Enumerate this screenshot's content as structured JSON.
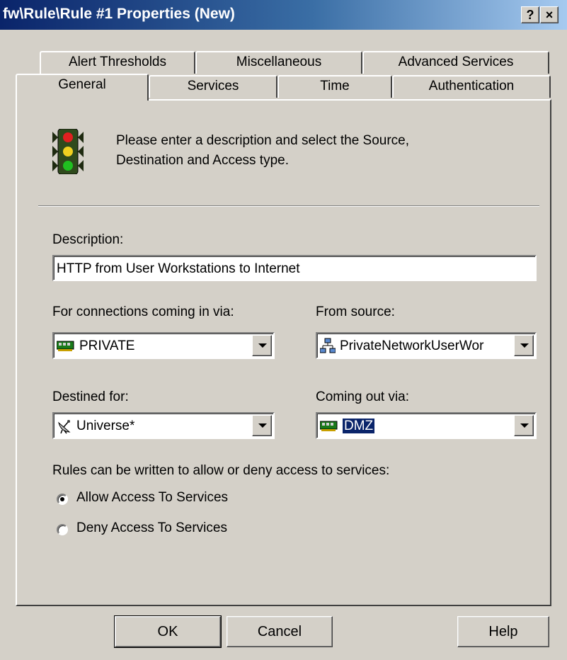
{
  "window": {
    "title": "fw\\Rule\\Rule #1 Properties (New)",
    "help_button": "?",
    "close_button": "×"
  },
  "tabs": {
    "row1": [
      "Alert Thresholds",
      "Miscellaneous",
      "Advanced Services"
    ],
    "row2": [
      "General",
      "Services",
      "Time",
      "Authentication"
    ],
    "active": "General"
  },
  "general": {
    "instruction_line1": "Please enter a description and select the Source,",
    "instruction_line2": "Destination and Access type.",
    "instruction_icon": "traffic-light-icon",
    "description_label": "Description:",
    "description_value": "HTTP from User Workstations to Internet",
    "incoming_label": "For connections coming in via:",
    "incoming_value": "PRIVATE",
    "incoming_icon": "network-card-icon",
    "source_label": "From source:",
    "source_value": "PrivateNetworkUserWor",
    "source_icon": "network-objects-icon",
    "destination_label": "Destined for:",
    "destination_value": "Universe*",
    "destination_icon": "satellite-dish-icon",
    "outgoing_label": "Coming out via:",
    "outgoing_value": "DMZ",
    "outgoing_icon": "network-card-icon",
    "access_label": "Rules can be written to allow or deny access to services:",
    "allow_label": "Allow Access To Services",
    "deny_label": "Deny Access To Services",
    "selected_access": "allow"
  },
  "buttons": {
    "ok": "OK",
    "cancel": "Cancel",
    "help": "Help"
  }
}
